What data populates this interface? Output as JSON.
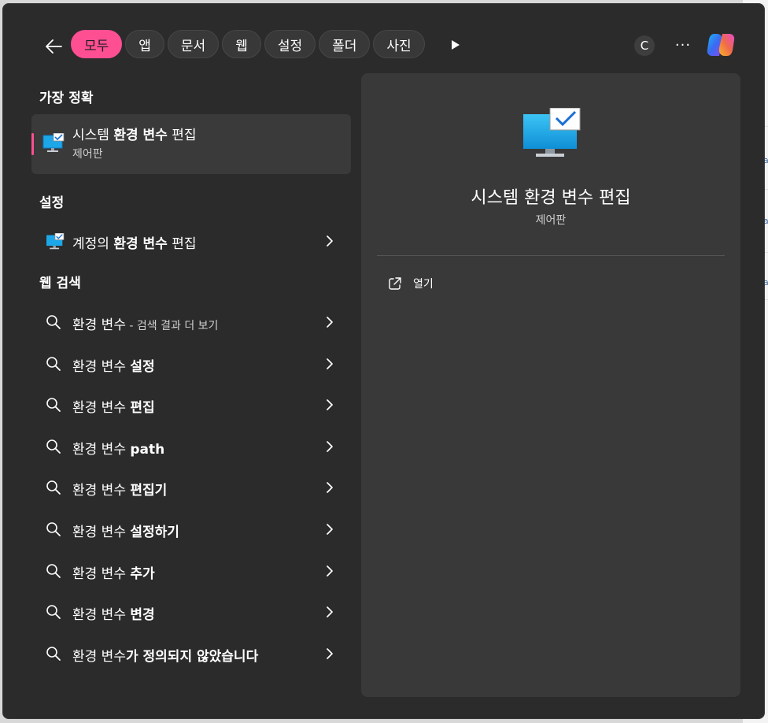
{
  "filters": {
    "chips": [
      {
        "label": "모두",
        "active": true
      },
      {
        "label": "앱",
        "active": false
      },
      {
        "label": "문서",
        "active": false
      },
      {
        "label": "웹",
        "active": false
      },
      {
        "label": "설정",
        "active": false
      },
      {
        "label": "폴더",
        "active": false
      },
      {
        "label": "사진",
        "active": false
      }
    ]
  },
  "header": {
    "avatar_letter": "C",
    "ellipsis": "···"
  },
  "best_match": {
    "section": "가장 정확",
    "title_parts": [
      [
        "시스템 ",
        false
      ],
      [
        "환경 변수",
        true
      ],
      [
        " 편집",
        false
      ]
    ],
    "subtitle": "제어판"
  },
  "settings": {
    "section": "설정",
    "items": [
      {
        "parts": [
          [
            "계정의 ",
            false
          ],
          [
            "환경 변수",
            true
          ],
          [
            " 편집",
            false
          ]
        ]
      }
    ]
  },
  "web": {
    "section": "웹 검색",
    "items": [
      {
        "parts": [
          [
            "환경 변수",
            false
          ]
        ],
        "suffix": " - 검색 결과 더 보기"
      },
      {
        "parts": [
          [
            "환경 변수 ",
            false
          ],
          [
            "설정",
            true
          ]
        ]
      },
      {
        "parts": [
          [
            "환경 변수 ",
            false
          ],
          [
            "편집",
            true
          ]
        ]
      },
      {
        "parts": [
          [
            "환경 변수 ",
            false
          ],
          [
            "path",
            true
          ]
        ]
      },
      {
        "parts": [
          [
            "환경 변수 ",
            false
          ],
          [
            "편집기",
            true
          ]
        ]
      },
      {
        "parts": [
          [
            "환경 변수 ",
            false
          ],
          [
            "설정하기",
            true
          ]
        ]
      },
      {
        "parts": [
          [
            "환경 변수 ",
            false
          ],
          [
            "추가",
            true
          ]
        ]
      },
      {
        "parts": [
          [
            "환경 변수 ",
            false
          ],
          [
            "변경",
            true
          ]
        ]
      },
      {
        "parts": [
          [
            "환경 변수",
            false
          ],
          [
            "가 정의되지 않았습니다",
            true
          ]
        ]
      }
    ]
  },
  "preview": {
    "title": "시스템 환경 변수 편집",
    "subtitle": "제어판",
    "actions": [
      {
        "label": "열기",
        "icon": "open-external-icon"
      }
    ]
  },
  "colors": {
    "accent": "#ff4f93",
    "window": "#2b2b2b",
    "panel": "#393939",
    "selected": "#3a3a3a"
  }
}
